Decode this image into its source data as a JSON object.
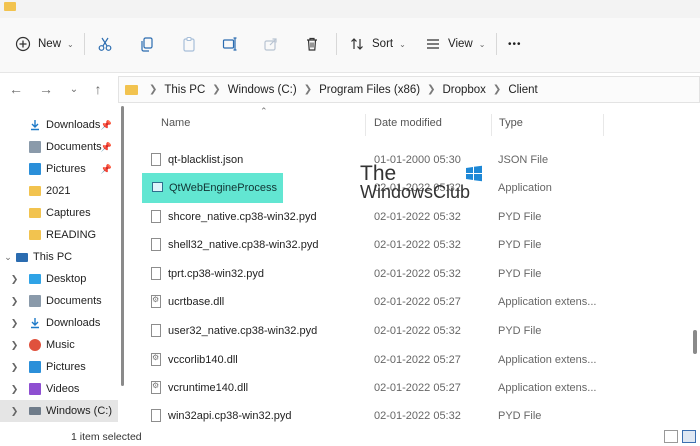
{
  "toolbar": {
    "new_label": "New",
    "sort_label": "Sort",
    "view_label": "View",
    "more_label": "•••"
  },
  "addressbar": {
    "crumbs": [
      "This PC",
      "Windows (C:)",
      "Program Files (x86)",
      "Dropbox",
      "Client"
    ]
  },
  "sidebar": {
    "quick_access": [
      {
        "label": "Downloads",
        "icon": "download-arrow-icon",
        "pinned": true
      },
      {
        "label": "Documents",
        "icon": "documents-icon",
        "pinned": true
      },
      {
        "label": "Pictures",
        "icon": "pictures-icon",
        "pinned": true
      },
      {
        "label": "2021",
        "icon": "folder-icon",
        "pinned": false
      },
      {
        "label": "Captures",
        "icon": "folder-icon",
        "pinned": false
      },
      {
        "label": "READING",
        "icon": "folder-icon",
        "pinned": false
      }
    ],
    "this_pc": {
      "label": "This PC",
      "icon": "computer-icon"
    },
    "this_pc_children": [
      {
        "label": "Desktop",
        "icon": "desktop-icon"
      },
      {
        "label": "Documents",
        "icon": "documents-icon"
      },
      {
        "label": "Downloads",
        "icon": "download-arrow-icon"
      },
      {
        "label": "Music",
        "icon": "music-icon"
      },
      {
        "label": "Pictures",
        "icon": "pictures-icon"
      },
      {
        "label": "Videos",
        "icon": "videos-icon"
      },
      {
        "label": "Windows (C:)",
        "icon": "drive-icon"
      }
    ]
  },
  "columns": {
    "name": "Name",
    "date": "Date modified",
    "type": "Type"
  },
  "files": [
    {
      "name": "qt-blacklist.json",
      "date": "01-01-2000 05:30",
      "type": "JSON File"
    },
    {
      "name": "QtWebEngineProcess",
      "date": "02-01-2022 05:32",
      "type": "Application"
    },
    {
      "name": "shcore_native.cp38-win32.pyd",
      "date": "02-01-2022 05:32",
      "type": "PYD File"
    },
    {
      "name": "shell32_native.cp38-win32.pyd",
      "date": "02-01-2022 05:32",
      "type": "PYD File"
    },
    {
      "name": "tprt.cp38-win32.pyd",
      "date": "02-01-2022 05:32",
      "type": "PYD File"
    },
    {
      "name": "ucrtbase.dll",
      "date": "02-01-2022 05:27",
      "type": "Application extens..."
    },
    {
      "name": "user32_native.cp38-win32.pyd",
      "date": "02-01-2022 05:32",
      "type": "PYD File"
    },
    {
      "name": "vccorlib140.dll",
      "date": "02-01-2022 05:27",
      "type": "Application extens..."
    },
    {
      "name": "vcruntime140.dll",
      "date": "02-01-2022 05:27",
      "type": "Application extens..."
    },
    {
      "name": "win32api.cp38-win32.pyd",
      "date": "02-01-2022 05:32",
      "type": "PYD File"
    }
  ],
  "watermark": {
    "line1": "The",
    "line2": "WindowsClub"
  },
  "status": {
    "selected_text": "1 item selected"
  },
  "colors": {
    "highlight": "#62e6d2",
    "selection": "#e5e5e5"
  }
}
